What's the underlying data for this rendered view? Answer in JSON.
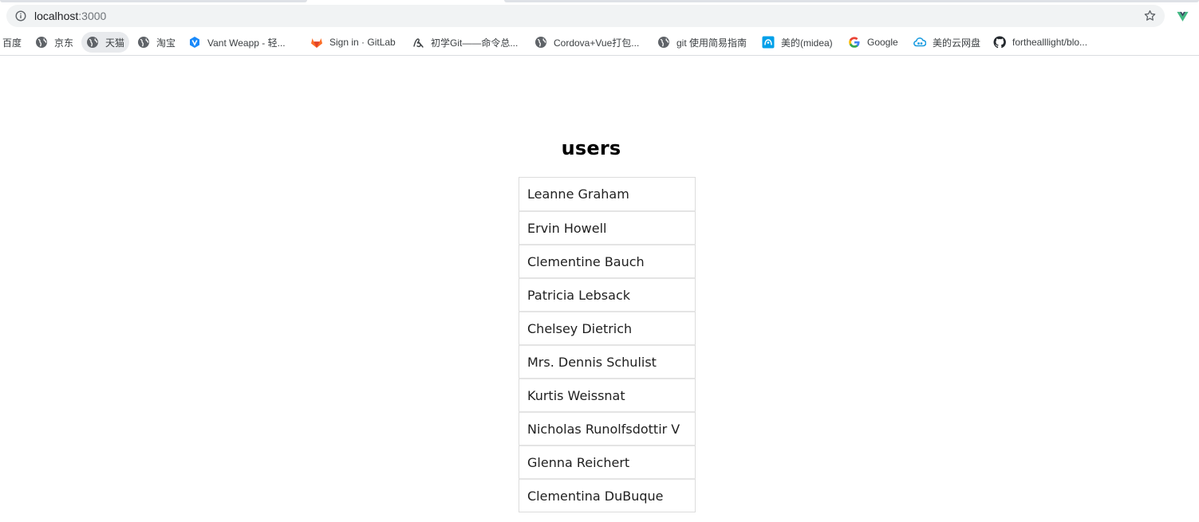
{
  "browser": {
    "address_host": "localhost",
    "address_port": ":3000",
    "bookmarks": [
      {
        "label": "百度",
        "icon": "baidu-icon"
      },
      {
        "label": "京东",
        "icon": "globe-icon"
      },
      {
        "label": "天猫",
        "icon": "globe-icon"
      },
      {
        "label": "淘宝",
        "icon": "globe-icon"
      },
      {
        "label": "Vant Weapp - 轻...",
        "icon": "vant-icon"
      },
      {
        "label": "Sign in · GitLab",
        "icon": "gitlab-icon"
      },
      {
        "label": "初学Git——命令总...",
        "icon": "blog-icon"
      },
      {
        "label": "Cordova+Vue打包...",
        "icon": "globe-icon"
      },
      {
        "label": "git 使用简易指南",
        "icon": "globe-icon"
      },
      {
        "label": "美的(midea)",
        "icon": "midea-icon"
      },
      {
        "label": "Google",
        "icon": "google-icon"
      },
      {
        "label": "美的云网盘",
        "icon": "cloud-drive-icon"
      },
      {
        "label": "forthealllight/blo...",
        "icon": "github-icon"
      }
    ],
    "colors": {
      "accent_ext": "#42b883",
      "gitlab": "#e24329",
      "vant": "#1989fa"
    }
  },
  "page": {
    "title": "users",
    "users": [
      "Leanne Graham",
      "Ervin Howell",
      "Clementine Bauch",
      "Patricia Lebsack",
      "Chelsey Dietrich",
      "Mrs. Dennis Schulist",
      "Kurtis Weissnat",
      "Nicholas Runolfsdottir V",
      "Glenna Reichert",
      "Clementina DuBuque"
    ]
  }
}
